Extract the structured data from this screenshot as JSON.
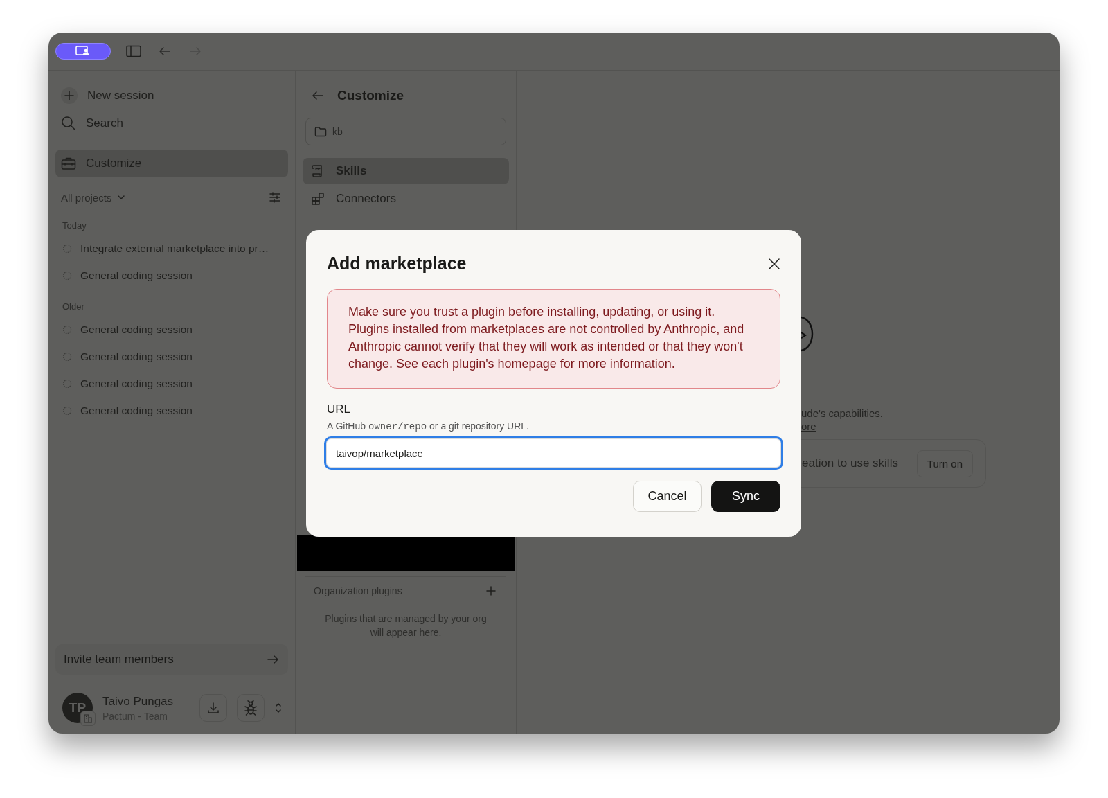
{
  "titlebar": {
    "back": {
      "disabled": false
    },
    "forward": {
      "disabled": true
    }
  },
  "sidebar": {
    "items": [
      {
        "kind": "new",
        "label": "New session",
        "selected": false
      },
      {
        "kind": "search",
        "label": "Search",
        "selected": false
      },
      {
        "kind": "customize",
        "label": "Customize",
        "selected": true
      }
    ],
    "filter": {
      "label": "All projects"
    },
    "groups": [
      {
        "title": "Today",
        "sessions": [
          "Integrate external marketplace into pr…",
          "General coding session"
        ]
      },
      {
        "title": "Older",
        "sessions": [
          "General coding session",
          "General coding session",
          "General coding session",
          "General coding session"
        ]
      }
    ],
    "invite": {
      "label": "Invite team members"
    },
    "user": {
      "initials": "TP",
      "name": "Taivo Pungas",
      "org": "Pactum - Team"
    }
  },
  "customize": {
    "title": "Customize",
    "folder": "kb",
    "nav": [
      {
        "kind": "skills",
        "label": "Skills",
        "selected": true
      },
      {
        "kind": "connectors",
        "label": "Connectors",
        "selected": false
      }
    ],
    "org_plugins": {
      "title": "Organization plugins",
      "empty": "Plugins that are managed by your org will appear here."
    }
  },
  "main": {
    "description": "ude's capabilities.",
    "link": "ore",
    "card": {
      "text": "eation to use skills",
      "button": "Turn on"
    }
  },
  "dialog": {
    "title": "Add marketplace",
    "warning": "Make sure you trust a plugin before installing, updating, or using it. Plugins installed from marketplaces are not controlled by Anthropic, and Anthropic cannot verify that they will work as intended or that they won't change. See each plugin's homepage for more information.",
    "field": {
      "label": "URL",
      "hint_before": "A GitHub",
      "hint_code": "owner/repo",
      "hint_after": "or a git repository URL.",
      "value": "taivop/marketplace"
    },
    "buttons": [
      {
        "kind": "secondary",
        "label": "Cancel"
      },
      {
        "kind": "primary",
        "label": "Sync"
      }
    ]
  }
}
